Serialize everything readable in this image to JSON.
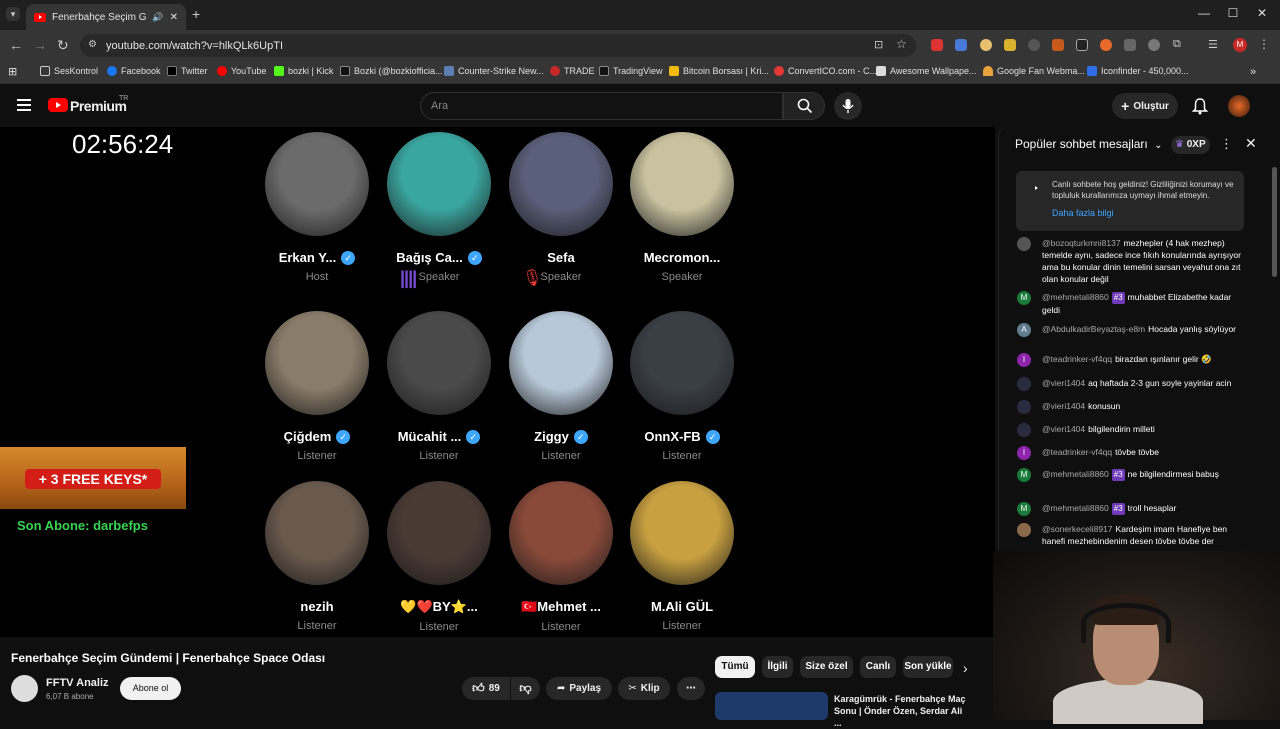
{
  "browser": {
    "tab_title": "Fenerbahçe Seçim Gündemi",
    "url": "youtube.com/watch?v=hlkQLk6UpTI",
    "bookmarks": [
      "SesKontrol",
      "Facebook",
      "Twitter",
      "YouTube",
      "bozki | Kick",
      "Bozki (@bozkiofficia...",
      "Counter-Strike New...",
      "TRADE",
      "TradingView",
      "Bitcoin Borsası | Kri...",
      "ConvertICO.com - C...",
      "Awesome Wallpape...",
      "Google Fan Webma...",
      "Iconfinder - 450,000..."
    ]
  },
  "masthead": {
    "logo_text": "Premium",
    "country": "TR",
    "search_placeholder": "Ara",
    "create_label": "Oluştur"
  },
  "player": {
    "timer": "02:56:24",
    "keys_banner": "+ 3 FREE KEYS*",
    "last_subscriber": "Son Abone: darbefps",
    "participants": [
      {
        "name": "Erkan Y...",
        "role": "Host",
        "verified": true,
        "color": "#6b6b6b"
      },
      {
        "name": "Bağış Ca...",
        "role": "Speaker",
        "verified": true,
        "color": "#3aa6a0"
      },
      {
        "name": "Sefa",
        "role": "Speaker",
        "verified": false,
        "color": "#5a5f7a"
      },
      {
        "name": "Mecromon...",
        "role": "Speaker",
        "verified": false,
        "color": "#c9c2a0"
      },
      {
        "name": "Çiğdem",
        "role": "Listener",
        "verified": true,
        "color": "#8a7c6a"
      },
      {
        "name": "Mücahit ...",
        "role": "Listener",
        "verified": true,
        "color": "#4a4a4a"
      },
      {
        "name": "Ziggy",
        "role": "Listener",
        "verified": true,
        "color": "#b8c8d8"
      },
      {
        "name": "OnnX-FB",
        "role": "Listener",
        "verified": true,
        "color": "#3a3f46"
      },
      {
        "name": "nezih",
        "role": "Listener",
        "verified": false,
        "color": "#6a5a4e"
      },
      {
        "name": "💛❤️BY⭐...",
        "role": "Listener",
        "verified": false,
        "color": "#4a3a34"
      },
      {
        "name": "🇹🇷Mehmet ...",
        "role": "Listener",
        "verified": false,
        "color": "#8a4a3a"
      },
      {
        "name": "M.Ali GÜL",
        "role": "Listener",
        "verified": false,
        "color": "#c8a040"
      }
    ]
  },
  "chat": {
    "header": "Popüler sohbet mesajları",
    "xp": "0XP",
    "welcome_text": "Canlı sohbete hoş geldiniz! Gizliliğinizi korumayı ve topluluk kurallarımıza uymayı ihmal etmeyin.",
    "welcome_link": "Daha fazla bilgi",
    "messages": [
      {
        "author": "@bozoqturkmni8137",
        "badge": "",
        "text": "mezhepler (4 hak mezhep) temelde aynı, sadece ince fıkıh konularında ayrışıyor ama bu konular dinin temelini sarsan veyahut ona zıt olan konular değil",
        "avatar": "",
        "avatar_color": "#555555"
      },
      {
        "author": "@mehmetali8860",
        "badge": "#3",
        "text": "muhabbet Elizabethe kadar geldi",
        "avatar": "M",
        "avatar_color": "#1a7a3a"
      },
      {
        "author": "@AbdulkadirBeyaztaş-e8m",
        "badge": "",
        "text": "Hocada yanlış söylüyor",
        "avatar": "A",
        "avatar_color": "#607d8b"
      },
      {
        "author": "@teadrinker-vf4qq",
        "badge": "",
        "text": "birazdan ışınlanır gelir 🤣",
        "avatar": "I",
        "avatar_color": "#8e24aa"
      },
      {
        "author": "@vieri1404",
        "badge": "",
        "text": "aq haftada 2-3 gun soyle yayinlar acin",
        "avatar": "",
        "avatar_color": "#2b2b40"
      },
      {
        "author": "@vieri1404",
        "badge": "",
        "text": "konusun",
        "avatar": "",
        "avatar_color": "#2b2b40"
      },
      {
        "author": "@vieri1404",
        "badge": "",
        "text": "bilgilendirin milleti",
        "avatar": "",
        "avatar_color": "#2b2b40"
      },
      {
        "author": "@teadrinker-vf4qq",
        "badge": "",
        "text": "tövbe tövbe",
        "avatar": "I",
        "avatar_color": "#8e24aa"
      },
      {
        "author": "@mehmetali8860",
        "badge": "#3",
        "text": "ne bilgilendirmesi babuş",
        "avatar": "M",
        "avatar_color": "#1a7a3a"
      },
      {
        "author": "@mehmetali8860",
        "badge": "#3",
        "text": "troll hesaplar",
        "avatar": "M",
        "avatar_color": "#1a7a3a"
      },
      {
        "author": "@sonerkeceli8917",
        "badge": "",
        "text": "Kardeşim imam Hanefiye ben hanefi mezhebindenim desen tövbe tövbe der",
        "avatar": "",
        "avatar_color": "#8a6a4a"
      }
    ]
  },
  "video": {
    "title": "Fenerbahçe Seçim Gündemi | Fenerbahçe Space Odası",
    "channel": "FFTV Analiz",
    "subscribers": "6,07 B abone",
    "subscribe_label": "Abone ol",
    "likes": "89",
    "share_label": "Paylaş",
    "clip_label": "Klip"
  },
  "chips": [
    "Tümü",
    "İlgili",
    "Size özel",
    "Canlı",
    "Son yükle"
  ],
  "related": {
    "title": "Karagümrük - Fenerbahçe Maç Sonu | Önder Özen, Serdar Ali ..."
  }
}
